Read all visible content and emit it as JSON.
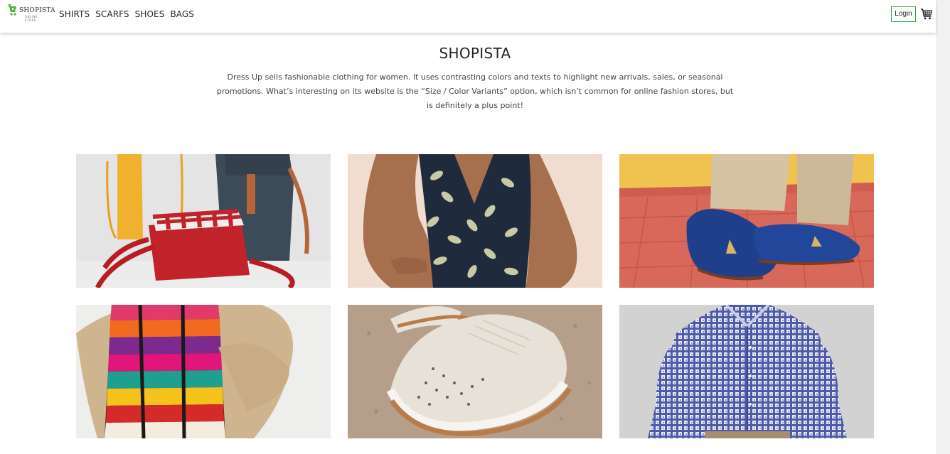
{
  "brand": {
    "name": "SHOPISTA",
    "tagline": "ONLINE STORE"
  },
  "nav": {
    "links": [
      "SHIRTS",
      "SCARFS",
      "SHOES",
      "BAGS"
    ],
    "login_label": "Login",
    "cart_icon": "cart-icon"
  },
  "hero": {
    "title": "SHOPISTA",
    "description": "Dress Up sells fashionable clothing for women. It uses contrasting colors and texts to highlight new arrivals, sales, or seasonal promotions. What’s interesting on its website is the “Size / Color Variants” option, which isn’t common for online fashion stores, but is definitely a plus point!"
  },
  "gallery": [
    {
      "category": "bags",
      "image": "bags-photo"
    },
    {
      "category": "shirts",
      "image": "leaf-print-top-photo"
    },
    {
      "category": "shoes",
      "image": "blue-loafers-photo"
    },
    {
      "category": "scarfs",
      "image": "striped-scarf-photo"
    },
    {
      "category": "shoes",
      "image": "white-sneakers-photo"
    },
    {
      "category": "shirts",
      "image": "checked-shirt-photo"
    }
  ],
  "colors": {
    "accent": "#28a745",
    "text": "#212529"
  }
}
